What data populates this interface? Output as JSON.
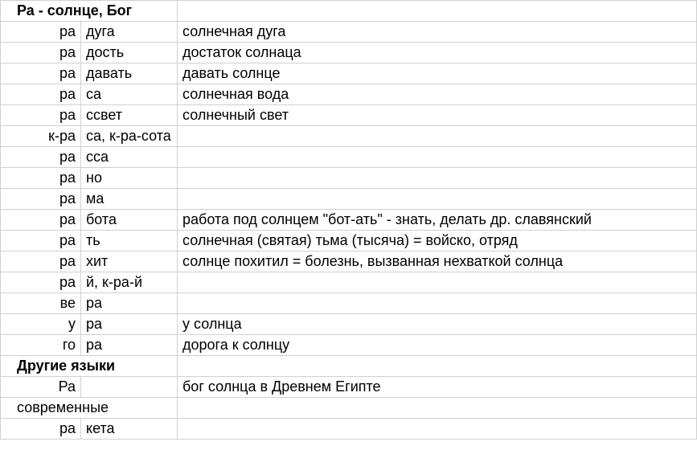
{
  "rows": [
    {
      "a": "Ра - солнце, Бог",
      "a_span": 2,
      "b": "",
      "c": "",
      "bold": true
    },
    {
      "a": "ра",
      "b": "дуга",
      "c": "солнечная дуга"
    },
    {
      "a": "ра",
      "b": "дость",
      "c": "достаток солнаца"
    },
    {
      "a": "ра",
      "b": "давать",
      "c": "давать солнце"
    },
    {
      "a": "ра",
      "b": "са",
      "c": "солнечная вода"
    },
    {
      "a": "ра",
      "b": "ссвет",
      "c": "солнечный свет"
    },
    {
      "a": "к-ра",
      "b": "са, к-ра-сота",
      "c": ""
    },
    {
      "a": "ра",
      "b": "сса",
      "c": ""
    },
    {
      "a": "ра",
      "b": "но",
      "c": ""
    },
    {
      "a": "ра",
      "b": "ма",
      "c": ""
    },
    {
      "a": "ра",
      "b": "бота",
      "c": "работа под солнцем \"бот-ать\" - знать, делать др. славянский"
    },
    {
      "a": "ра",
      "b": "ть",
      "c": "солнечная (святая) тьма (тысяча) = войско, отряд"
    },
    {
      "a": "ра",
      "b": "хит",
      "c": "солнце похитил = болезнь, вызванная нехваткой солнца"
    },
    {
      "a": "ра",
      "b": "й, к-ра-й",
      "c": ""
    },
    {
      "a": "ве",
      "b": "ра",
      "c": ""
    },
    {
      "a": "у",
      "b": "ра",
      "c": "у солнца"
    },
    {
      "a": "го",
      "b": "ра",
      "c": "дорога к солнцу"
    },
    {
      "a": "Другие языки",
      "a_span": 2,
      "b": "",
      "c": "",
      "bold": true
    },
    {
      "a": "Ра",
      "b": "",
      "c": "бог солнца в Древнем Египте"
    },
    {
      "a": "современные",
      "a_span": 2,
      "b": "",
      "c": ""
    },
    {
      "a": "ра",
      "b": "кета",
      "c": ""
    }
  ]
}
